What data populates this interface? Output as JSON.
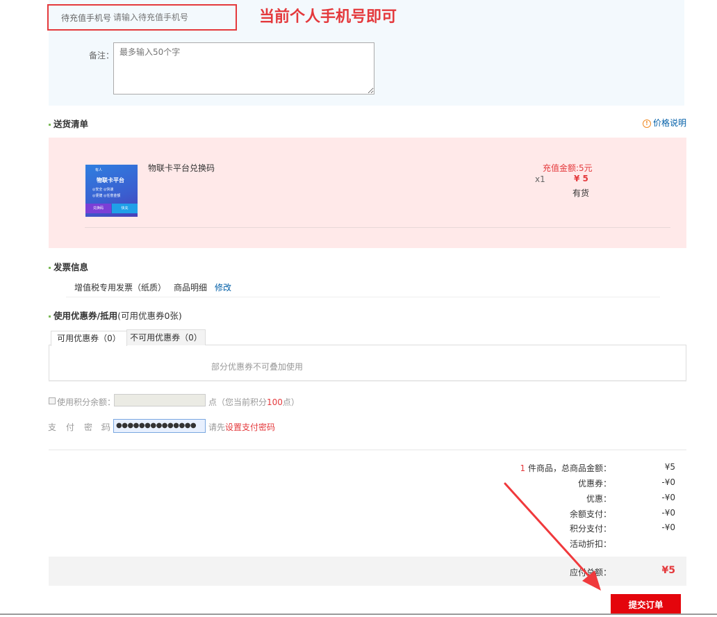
{
  "recharge": {
    "phone_label": "待充值手机号",
    "phone_placeholder": "请输入待充值手机号",
    "annotation": "当前个人手机号即可",
    "remark_label": "备注：",
    "remark_placeholder": "最多输入50个字"
  },
  "delivery": {
    "title": "送货清单",
    "price_note": "价格说明",
    "item": {
      "name": "物联卡平台兑换码",
      "recharge_amount": "充值金额:5元",
      "qty": "x1",
      "price": "¥ 5",
      "stock": "有货",
      "image": {
        "brand": "有人",
        "title": "物联卡平台",
        "features_line1": "◎安全  ◎快速",
        "features_line2": "◎便捷  ◎任意金额",
        "btn_left": "兑换码",
        "btn_right": "快充"
      }
    }
  },
  "invoice": {
    "title": "发票信息",
    "type": "增值税专用发票（纸质）",
    "detail": "商品明细",
    "edit": "修改"
  },
  "coupon": {
    "title": "使用优惠券/抵用",
    "title_suffix": "(可用优惠券0张)",
    "tab_available": "可用优惠券（0）",
    "tab_unavailable": "不可用优惠券（0）",
    "message": "部分优惠券不可叠加使用"
  },
  "points": {
    "label": "使用积分余额：",
    "unit_prefix": "点（您当前积分",
    "value": "100",
    "unit_suffix": "点）"
  },
  "password": {
    "label": "支付密码",
    "colon": "：",
    "masked_value": "●●●●●●●●●●●●●●",
    "hint_prefix": "请先",
    "hint_link": "设置支付密码"
  },
  "summary": {
    "count": "1",
    "count_label": "件商品，总商品金额：",
    "total": "¥5",
    "coupon_label": "优惠券：",
    "coupon_val": "-¥0",
    "discount_label": "优惠：",
    "discount_val": "-¥0",
    "balance_label": "余额支付：",
    "balance_val": "-¥0",
    "points_label": "积分支付：",
    "points_val": "-¥0",
    "activity_label": "活动折扣：",
    "due_label": "应付总额：",
    "due_val": "¥5"
  },
  "submit_label": "提交订单",
  "colors": {
    "accent_red": "#e4393c",
    "submit_red": "#e4050c",
    "link_blue": "#005ea7",
    "pink_bg": "#ffe9e9",
    "blue_bg": "#f3f9fd"
  }
}
